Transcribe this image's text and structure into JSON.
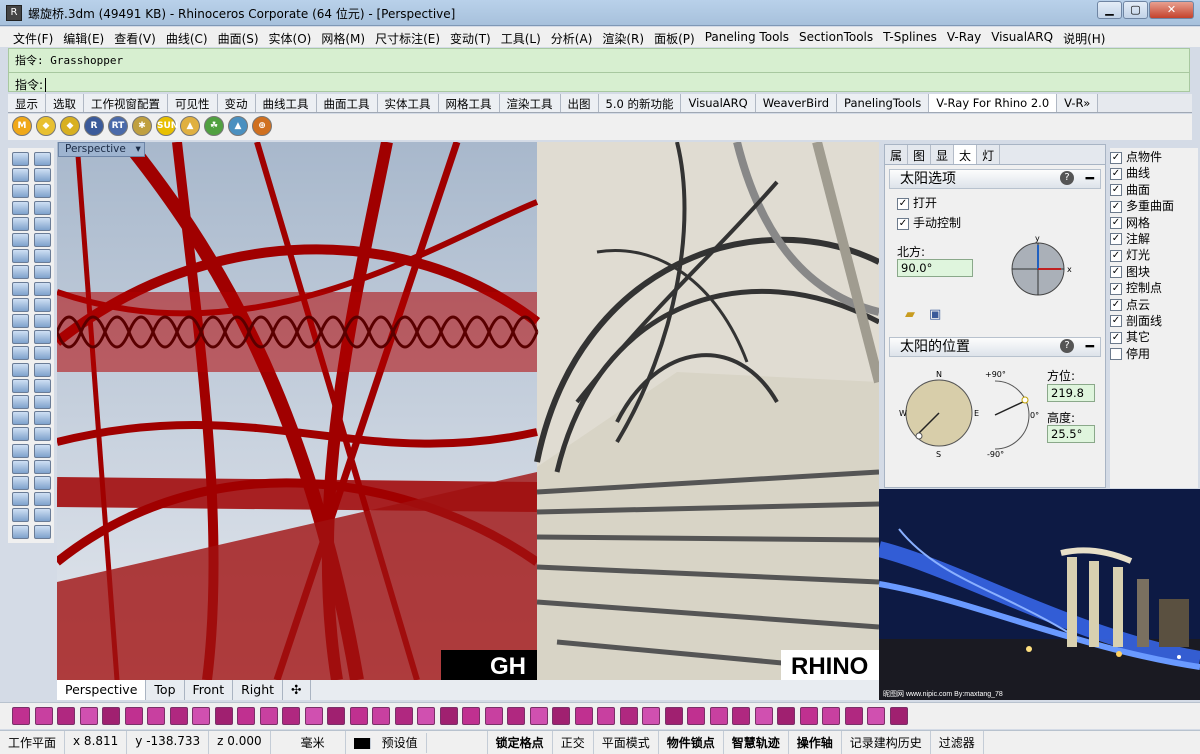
{
  "window": {
    "title": "螺旋桥.3dm (49491 KB) - Rhinoceros Corporate (64 位元) - [Perspective]",
    "min": "▁",
    "max": "▢",
    "close": "✕"
  },
  "menu": [
    "文件(F)",
    "编辑(E)",
    "查看(V)",
    "曲线(C)",
    "曲面(S)",
    "实体(O)",
    "网格(M)",
    "尺寸标注(E)",
    "变动(T)",
    "工具(L)",
    "分析(A)",
    "渲染(R)",
    "面板(P)",
    "Paneling Tools",
    "SectionTools",
    "T-Splines",
    "V-Ray",
    "VisualARQ",
    "说明(H)"
  ],
  "command": {
    "history": "指令: Grasshopper",
    "prompt": "指令:"
  },
  "toolbar_tabs": [
    "显示",
    "选取",
    "工作视窗配置",
    "可见性",
    "变动",
    "曲线工具",
    "曲面工具",
    "实体工具",
    "网格工具",
    "渲染工具",
    "出图",
    "5.0 的新功能",
    "VisualARQ",
    "WeaverBird",
    "PanelingTools",
    "V-Ray For Rhino 2.0",
    "V-R»"
  ],
  "toolbar_icons": [
    {
      "name": "m-icon",
      "glyph": "M",
      "color": "#f0a818"
    },
    {
      "name": "tag-icon",
      "glyph": "◆",
      "color": "#e8c030"
    },
    {
      "name": "tags-icon",
      "glyph": "◆",
      "color": "#d8b020"
    },
    {
      "name": "r-icon",
      "glyph": "R",
      "color": "#3a5a9a"
    },
    {
      "name": "rt-icon",
      "glyph": "RT",
      "color": "#4a6aaa"
    },
    {
      "name": "light-icon",
      "glyph": "✱",
      "color": "#c0a040"
    },
    {
      "name": "sun-icon",
      "glyph": "SUN",
      "color": "#e8c000"
    },
    {
      "name": "dome-icon",
      "glyph": "▲",
      "color": "#e0b040"
    },
    {
      "name": "env-icon",
      "glyph": "☘",
      "color": "#50a040"
    },
    {
      "name": "landscape-icon",
      "glyph": "▲",
      "color": "#4a90c0"
    },
    {
      "name": "target-icon",
      "glyph": "⊕",
      "color": "#d07020"
    }
  ],
  "viewport": {
    "name": "Perspective",
    "label_left": "GH",
    "label_right": "RHINO"
  },
  "viewport_tabs": [
    "Perspective",
    "Top",
    "Front",
    "Right",
    "✣"
  ],
  "panel": {
    "tabs": [
      "属",
      "图",
      "显",
      "太",
      "灯"
    ],
    "sun_options": {
      "title": "太阳选项",
      "on": "打开",
      "manual": "手动控制",
      "north_label": "北方:",
      "north_value": "90.0°",
      "z": "z",
      "y": "y",
      "x": "x"
    },
    "sun_position": {
      "title": "太阳的位置",
      "azimuth_label": "方位:",
      "azimuth_value": "219.8",
      "altitude_label": "高度:",
      "altitude_value": "25.5°",
      "N": "N",
      "S": "S",
      "E": "E",
      "W": "W",
      "plus90": "+90°",
      "minus90": "-90°",
      "zero": "0°"
    }
  },
  "layers": [
    {
      "label": "点物件",
      "checked": true
    },
    {
      "label": "曲线",
      "checked": true
    },
    {
      "label": "曲面",
      "checked": true
    },
    {
      "label": "多重曲面",
      "checked": true
    },
    {
      "label": "网格",
      "checked": true
    },
    {
      "label": "注解",
      "checked": true
    },
    {
      "label": "灯光",
      "checked": true
    },
    {
      "label": "图块",
      "checked": true
    },
    {
      "label": "控制点",
      "checked": true
    },
    {
      "label": "点云",
      "checked": true
    },
    {
      "label": "剖面线",
      "checked": true
    },
    {
      "label": "其它",
      "checked": true
    },
    {
      "label": "停用",
      "checked": false
    }
  ],
  "photo_watermark": "昵图网 www.nipic.com   By:maxtang_78",
  "status": {
    "cplane": "工作平面",
    "x": "x 8.811",
    "y": "y -138.733",
    "z": "z 0.000",
    "unit": "毫米",
    "layer": "预设值",
    "snap": "锁定格点",
    "ortho": "正交",
    "planar": "平面模式",
    "osnap": "物件锁点",
    "smarttrack": "智慧轨迹",
    "gumball": "操作轴",
    "history": "记录建构历史",
    "filter": "过滤器"
  }
}
